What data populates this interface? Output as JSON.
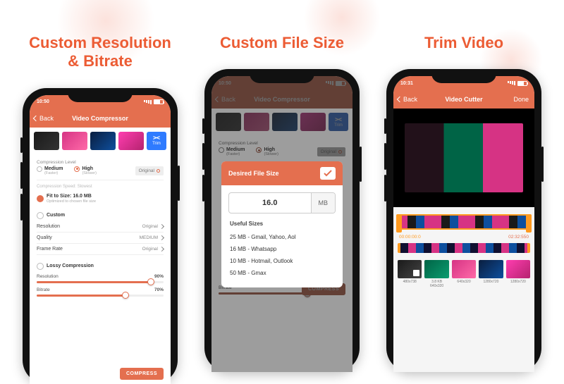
{
  "accent": "#ec5c34",
  "headlines": {
    "col1_line1": "Custom Resolution",
    "col1_line2": "& Bitrate",
    "col2": "Custom File Size",
    "col3": "Trim Video"
  },
  "statusbar": {
    "time1": "10:50",
    "time2": "10:50",
    "time3": "10:31"
  },
  "nav": {
    "back": "Back",
    "title_compressor": "Video Compressor",
    "title_cutter": "Video Cutter",
    "done": "Done"
  },
  "trim_button": "Trim",
  "compression": {
    "section_label": "Compression Level",
    "medium": "Medium",
    "medium_sub": "(Faster)",
    "high": "High",
    "high_sub": "(Slower)",
    "original": "Original",
    "speed_note": "Compression Speed: Slowest",
    "fit_label": "Fit to Size: 16.0 MB",
    "fit_sub": "Optimized to chosen file size",
    "custom": "Custom",
    "resolution": "Resolution",
    "resolution_val": "Original",
    "quality": "Quality",
    "quality_val": "MEDIUM",
    "framerate": "Frame Rate",
    "framerate_val": "Original",
    "lossy": "Lossy Compression",
    "res_slider_label": "Resolution",
    "res_slider_val": "90%",
    "bitrate_label": "Bitrate",
    "bitrate_val": "70%",
    "compress_btn": "COMPRESS"
  },
  "modal": {
    "title": "Desired File Size",
    "value": "16.0",
    "unit": "MB",
    "useful_label": "Useful Sizes",
    "sizes": [
      "25 MB - Gmail, Yahoo, Aol",
      "16 MB - Whatsapp",
      "10 MB - Hotmail, Outlook",
      "50 MB - Gmax"
    ]
  },
  "cutter": {
    "start": "00:00:00:0",
    "end": "02:32:550",
    "clips": [
      "480x738",
      "3.8 KB 640x320",
      "640x320",
      "1280x720",
      "1280x720"
    ]
  }
}
